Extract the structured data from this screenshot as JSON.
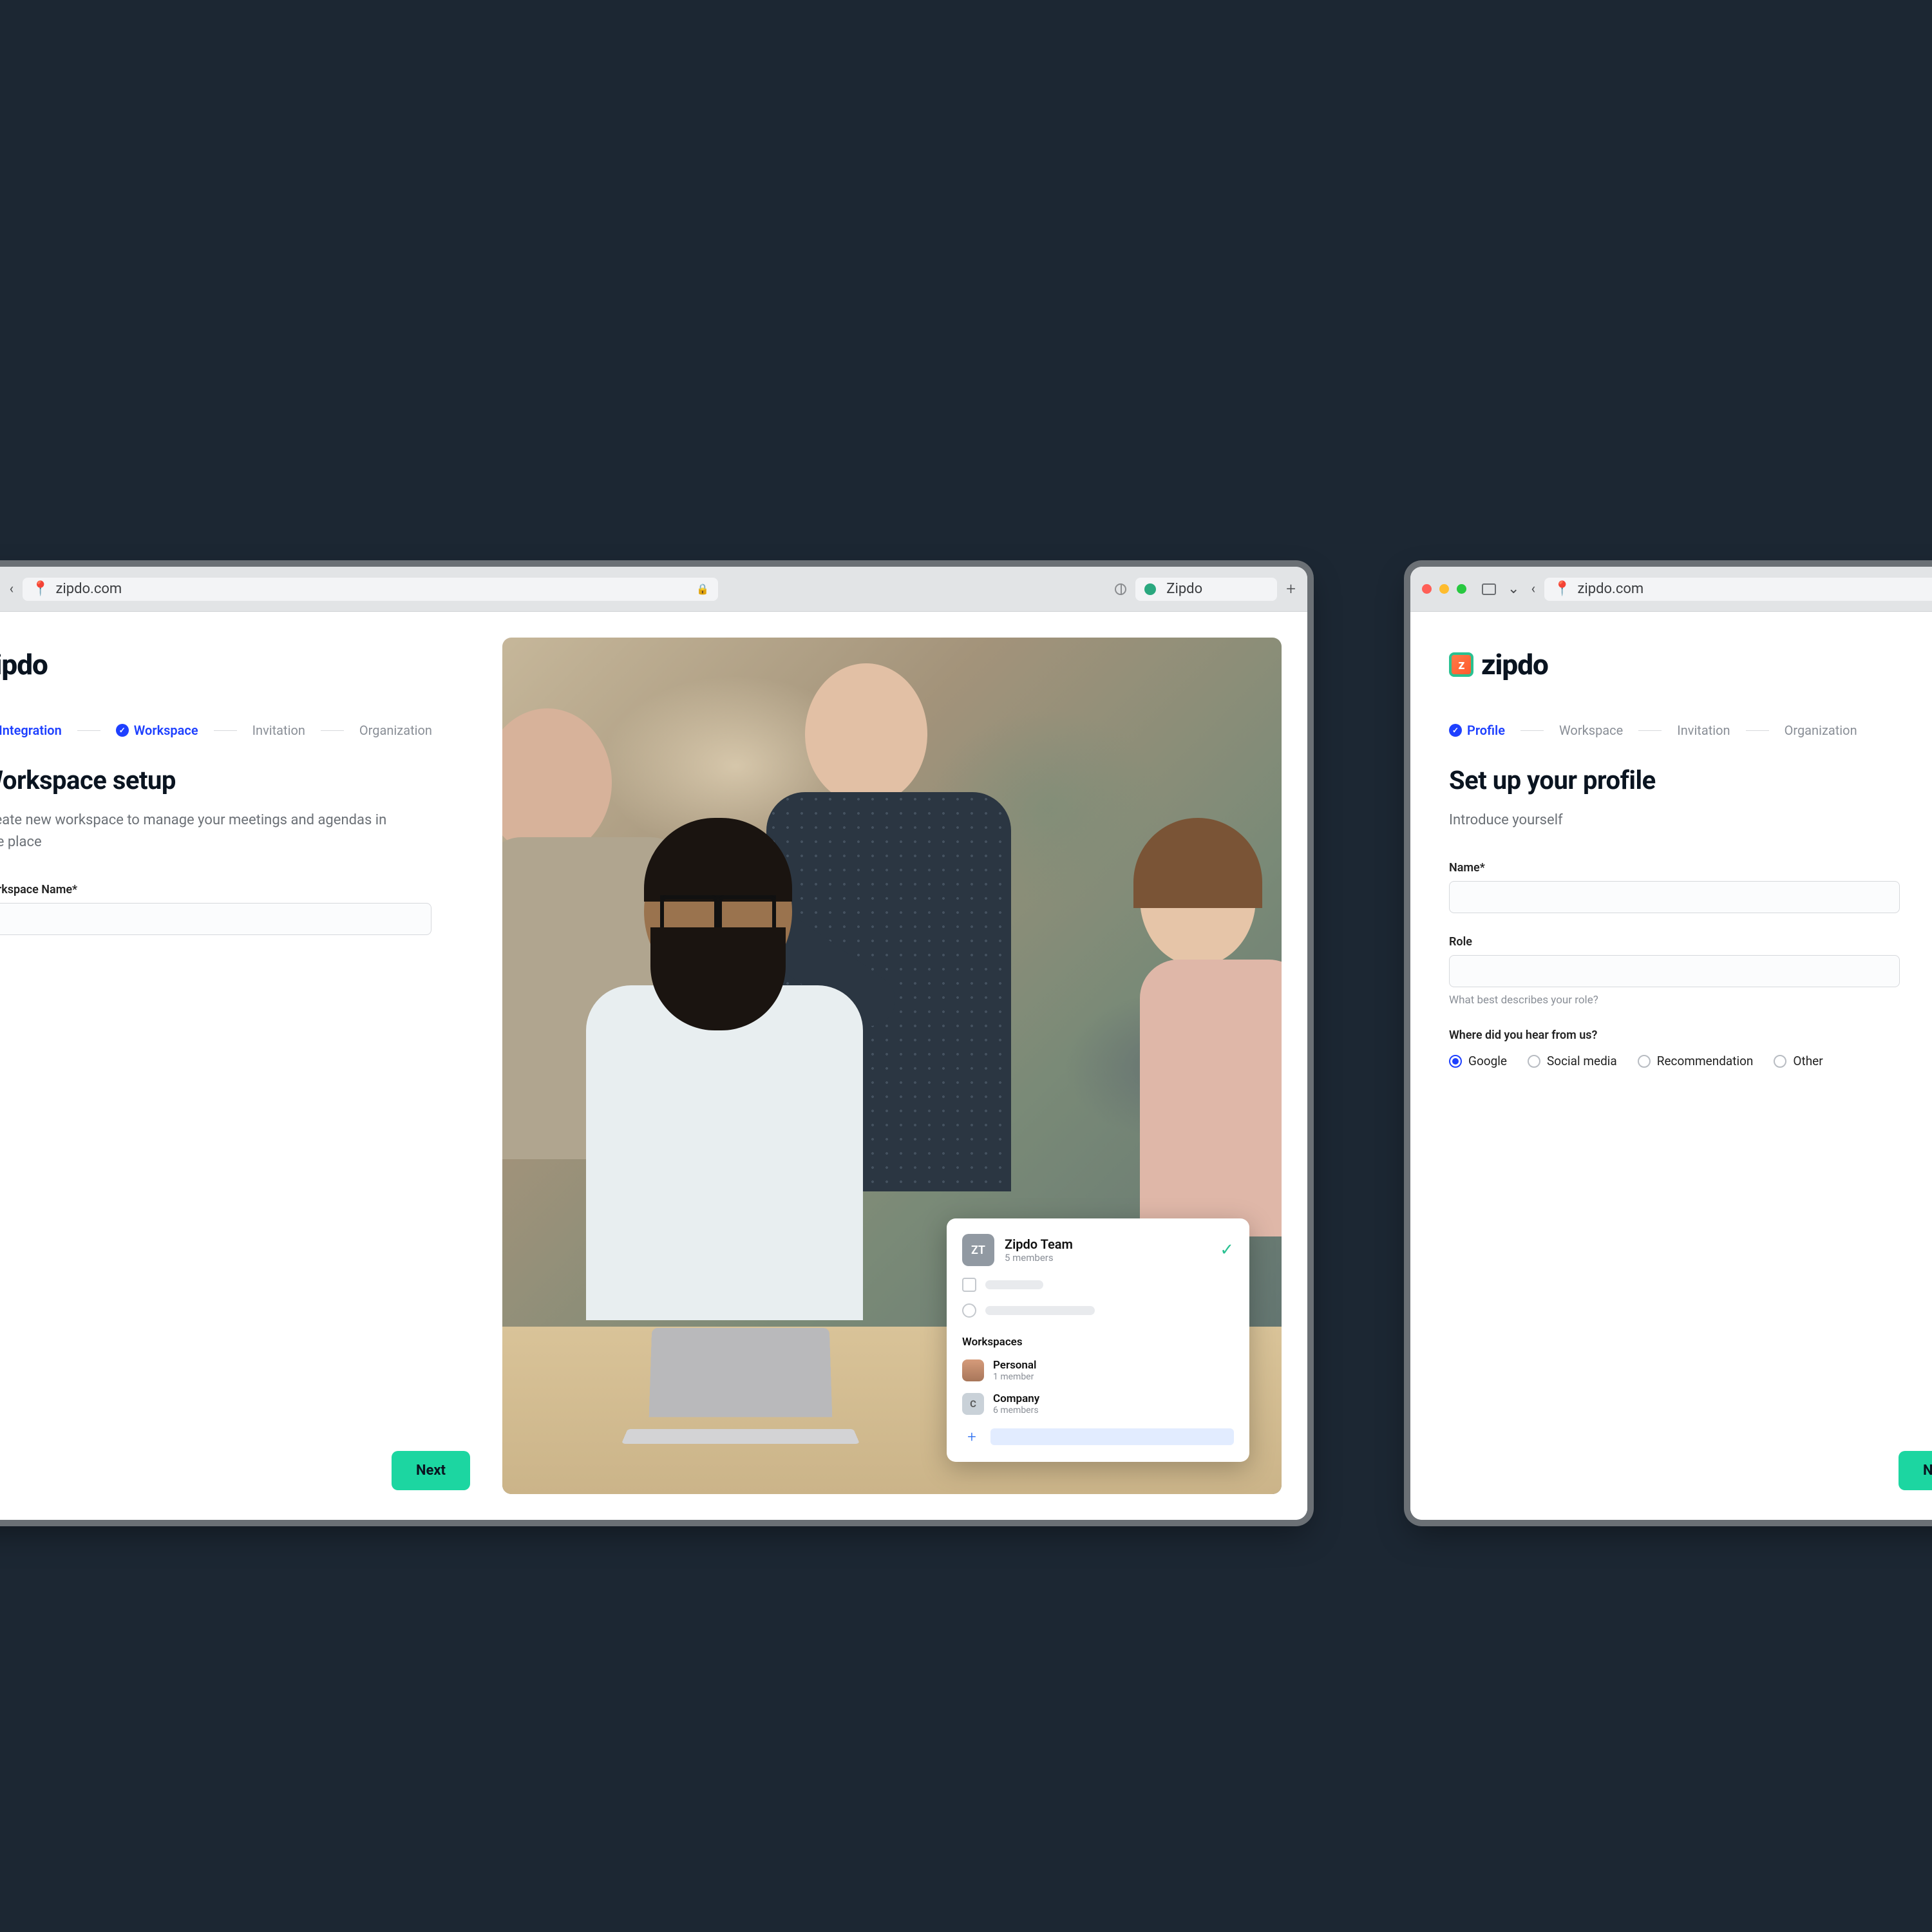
{
  "browser": {
    "url": "zipdo.com",
    "tab2_label": "Zipdo"
  },
  "brand": "zipdo",
  "left_window": {
    "steps": [
      "Integration",
      "Workspace",
      "Invitation",
      "Organization"
    ],
    "active_step_index": 1,
    "title": "Workspace setup",
    "subtitle": "Create new workspace to manage your meetings and agendas in one place",
    "field_label": "Workspace Name*",
    "next_label": "Next",
    "overlay": {
      "team_initials": "ZT",
      "team_name": "Zipdo Team",
      "team_members": "5 members",
      "section_label": "Workspaces",
      "workspaces": [
        {
          "initial": "",
          "name": "Personal",
          "meta": "1 member"
        },
        {
          "initial": "C",
          "name": "Company",
          "meta": "6 members"
        }
      ]
    }
  },
  "right_window": {
    "steps": [
      "Profile",
      "Workspace",
      "Invitation",
      "Organization"
    ],
    "active_step_index": 0,
    "title": "Set up your profile",
    "subtitle": "Introduce yourself",
    "name_label": "Name*",
    "role_label": "Role",
    "role_hint": "What best describes your role?",
    "hear_label": "Where did you hear from us?",
    "hear_options": [
      "Google",
      "Social media",
      "Recommendation",
      "Other"
    ],
    "hear_selected": "Google",
    "next_label": "Next"
  }
}
